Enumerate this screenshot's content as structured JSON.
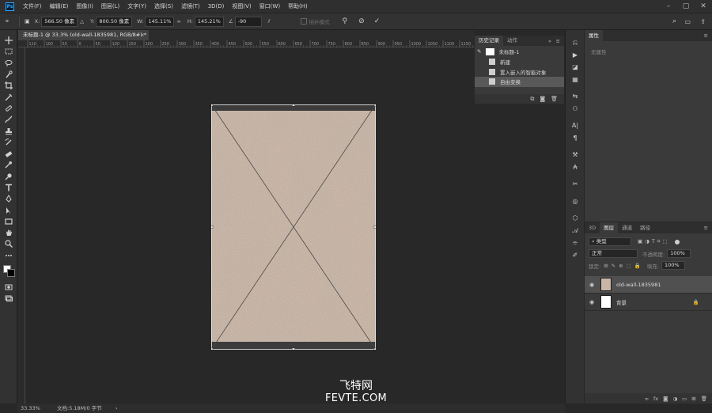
{
  "app": {
    "logo": "Ps"
  },
  "menu": [
    "文件(F)",
    "编辑(E)",
    "图像(I)",
    "图层(L)",
    "文字(Y)",
    "选择(S)",
    "滤镜(T)",
    "3D(D)",
    "视图(V)",
    "窗口(W)",
    "帮助(H)"
  ],
  "options": {
    "x_label": "X:",
    "x_value": "566.50 像素",
    "y_label": "Y:",
    "y_value": "800.50 像素",
    "w_label": "W:",
    "w_value": "145.11%",
    "h_label": "H:",
    "h_value": "145.21%",
    "angle_value": "-90",
    "interp_label": "插补模式"
  },
  "document": {
    "tab_title": "未标题-1 @ 33.3% (old-wall-1835981, RGB/8#) *",
    "zoom": "33.33%",
    "doc_info": "文档:5.18M/0 字节",
    "ruler_ticks": [
      "110",
      "100",
      "50",
      "0",
      "50",
      "100",
      "150",
      "200",
      "250",
      "300",
      "350",
      "400",
      "450",
      "500",
      "550",
      "600",
      "650",
      "700",
      "750",
      "800",
      "850",
      "900",
      "950",
      "1000",
      "1050",
      "1100",
      "1150"
    ]
  },
  "history": {
    "tabs": [
      "历史记录",
      "动作"
    ],
    "snapshot": "未标题-1",
    "items": [
      {
        "label": "新建",
        "active": false
      },
      {
        "label": "置入嵌入的智能对象",
        "active": false
      },
      {
        "label": "自由变换",
        "active": true
      }
    ]
  },
  "properties": {
    "tab": "属性",
    "empty_text": "无属性"
  },
  "layers": {
    "tabs": [
      "3D",
      "图层",
      "通道",
      "路径"
    ],
    "filter_label": "类型",
    "blend_mode": "正常",
    "opacity_label": "不透明度:",
    "opacity_value": "100%",
    "lock_label": "锁定:",
    "fill_label": "填充:",
    "fill_value": "100%",
    "items": [
      {
        "name": "old-wall-1835981",
        "active": true
      },
      {
        "name": "背景",
        "active": false
      }
    ]
  },
  "watermark": {
    "cn": "飞特网",
    "en": "FEVTE.COM"
  },
  "colors": {
    "accent": "#31a8ff",
    "canvas_bg": "#282828",
    "texture": "#c9b6a6"
  }
}
